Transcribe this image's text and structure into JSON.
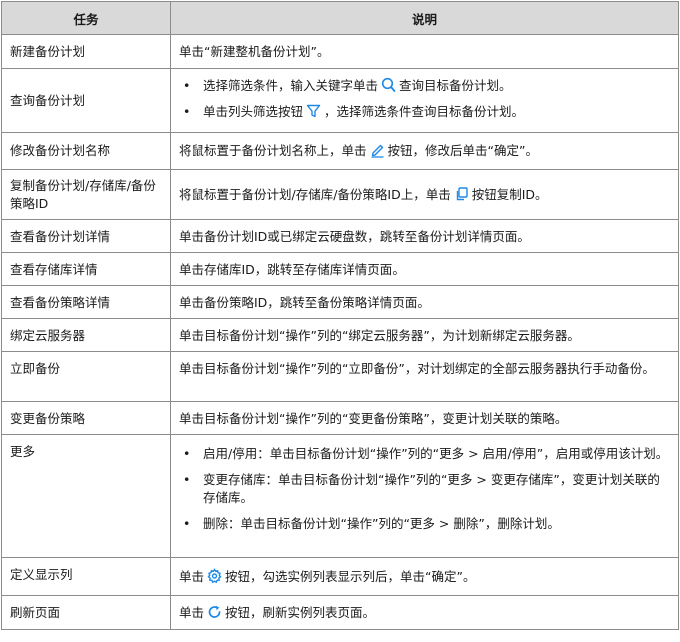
{
  "header": {
    "task": "任务",
    "desc": "说明"
  },
  "rows": {
    "r1": {
      "task": "新建备份计划",
      "desc": "单击“新建整机备份计划”。"
    },
    "r2": {
      "task": "查询备份计划",
      "b1a": "选择筛选条件，输入关键字单击",
      "b1b": "查询目标备份计划。",
      "b2a": "单击列头筛选按钮",
      "b2b": "，选择筛选条件查询目标备份计划。"
    },
    "r3": {
      "task": "修改备份计划名称",
      "a": "将鼠标置于备份计划名称上，单击",
      "b": "按钮，修改后单击“确定”。"
    },
    "r4": {
      "task": "复制备份计划/存储库/备份策略ID",
      "a": "将鼠标置于备份计划/存储库/备份策略ID上，单击",
      "b": "按钮复制ID。"
    },
    "r5": {
      "task": "查看备份计划详情",
      "desc": "单击备份计划ID或已绑定云硬盘数，跳转至备份计划详情页面。"
    },
    "r6": {
      "task": "查看存储库详情",
      "desc": "单击存储库ID，跳转至存储库详情页面。"
    },
    "r7": {
      "task": "查看备份策略详情",
      "desc": "单击备份策略ID，跳转至备份策略详情页面。"
    },
    "r8": {
      "task": "绑定云服务器",
      "desc": "单击目标备份计划“操作”列的“绑定云服务器”，为计划新绑定云服务器。"
    },
    "r9": {
      "task": "立即备份",
      "desc": "单击目标备份计划“操作”列的“立即备份”，对计划绑定的全部云服务器执行手动备份。"
    },
    "r10": {
      "task": "变更备份策略",
      "desc": "单击目标备份计划“操作”列的“变更备份策略”，变更计划关联的策略。"
    },
    "r11": {
      "task": "更多",
      "b1": "启用/停用：单击目标备份计划“操作”列的“更多 > 启用/停用”，启用或停用该计划。",
      "b2": "变更存储库：单击目标备份计划“操作”列的“更多 > 变更存储库”，变更计划关联的存储库。",
      "b3": "删除：单击目标备份计划“操作”列的“更多 > 删除”，删除计划。"
    },
    "r12": {
      "task": "定义显示列",
      "a": "单击",
      "b": "按钮，勾选实例列表显示列后，单击“确定”。"
    },
    "r13": {
      "task": "刷新页面",
      "a": "单击",
      "b": "按钮，刷新实例列表页面。"
    }
  },
  "bullet": "•",
  "icons": {
    "search": "search-icon",
    "filter": "filter-icon",
    "edit": "edit-icon",
    "copy": "copy-icon",
    "settings": "gear-icon",
    "refresh": "refresh-icon"
  },
  "colors": {
    "header_bg": "#d9d9d9",
    "border": "#8c8c8c",
    "icon": "#1e88e5"
  }
}
